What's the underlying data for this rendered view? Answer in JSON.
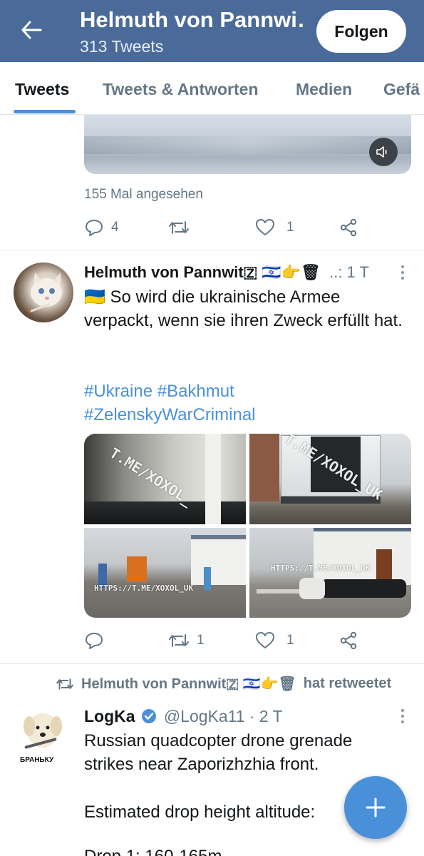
{
  "header": {
    "title": "Helmuth von Pannwi…",
    "subtitle": "313 Tweets",
    "follow_label": "Folgen"
  },
  "tabs": [
    {
      "label": "Tweets",
      "active": true
    },
    {
      "label": "Tweets & Antworten",
      "active": false
    },
    {
      "label": "Medien",
      "active": false
    },
    {
      "label": "Gefä",
      "active": false
    }
  ],
  "tweet1": {
    "views": "155 Mal angesehen",
    "reply_count": "4",
    "retweet_count": "",
    "like_count": "1"
  },
  "tweet2": {
    "author": "Helmuth von Pannwit🇿 🇮🇱👉🗑",
    "meta": "..: 1 T",
    "body": "🇺🇦 So wird die ukrainische Armee verpackt, wenn sie ihren Zweck erfüllt hat.",
    "hashtags_line1": "#Ukraine #Bakhmut",
    "hashtags_line2": "#ZelenskyWarCriminal",
    "watermarks": [
      "T.ME/XOXOL_",
      "T.ME/XOXOL_UK",
      "HTTPS://T.ME/XOXOL_UK",
      "HTTPS://T.ME/XOXOL_UK"
    ],
    "reply_count": "",
    "retweet_count": "1",
    "like_count": "1"
  },
  "retweet_notice": {
    "name": "Helmuth von Pannwit🇿 🇮🇱👉🗑",
    "suffix": "hat retweetet"
  },
  "tweet3": {
    "author": "LogKa",
    "handle": "@LogKa11",
    "time": "· 2 T",
    "avatar_caption": "БРАНЬКУ",
    "line1": "Russian quadcopter drone grenade",
    "line2": "strikes near Zaporizhzhia front.",
    "line3": "Estimated drop height altitude:",
    "line4": "Drop 1: 160-165m"
  },
  "colors": {
    "header_bg": "#4a6b99",
    "accent": "#4a90d9",
    "muted": "#657786"
  }
}
